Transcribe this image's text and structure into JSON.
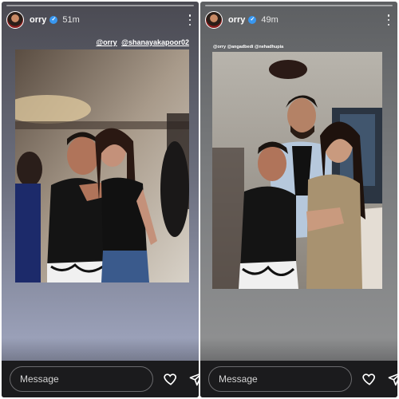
{
  "stories": [
    {
      "username": "orry",
      "time": "51m",
      "progress": 0.0,
      "mentions": [
        "@orry",
        "@shanayakapoor02"
      ],
      "message_placeholder": "Message",
      "icons": [
        "avatar",
        "verified-badge-icon",
        "more-options-icon",
        "heart-icon",
        "send-icon"
      ]
    },
    {
      "username": "orry",
      "time": "49m",
      "progress": 0.0,
      "mentions_text": "@orry @angadbedi @nehadhupia",
      "message_placeholder": "Message",
      "icons": [
        "avatar",
        "verified-badge-icon",
        "more-options-icon",
        "heart-icon",
        "send-icon"
      ]
    }
  ],
  "colors": {
    "verified": "#3897f0",
    "footer": "#1b1b1d",
    "text": "#ffffff"
  }
}
